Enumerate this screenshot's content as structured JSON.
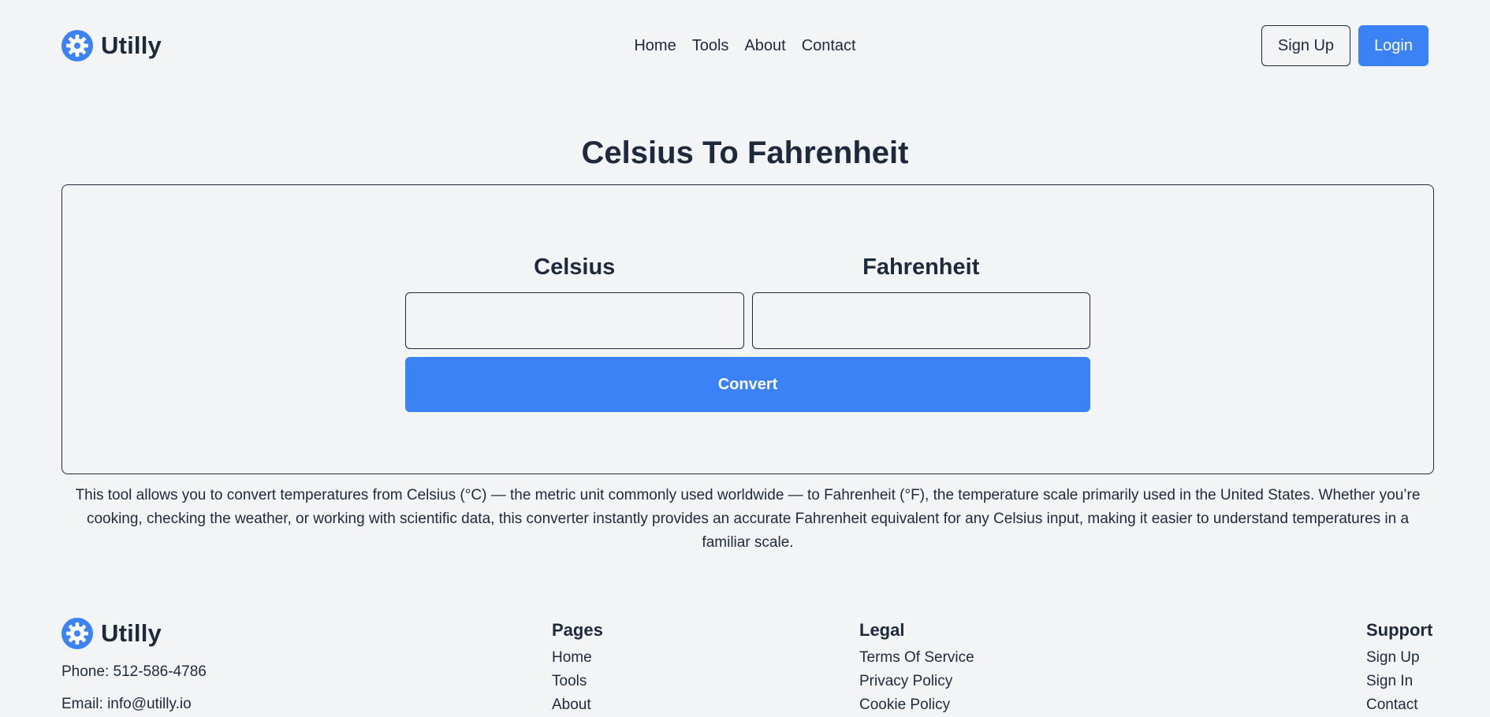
{
  "header": {
    "brand": "Utilly",
    "nav": [
      "Home",
      "Tools",
      "About",
      "Contact"
    ],
    "signup_label": "Sign Up",
    "login_label": "Login"
  },
  "main": {
    "title": "Celsius To Fahrenheit",
    "celsius_label": "Celsius",
    "fahrenheit_label": "Fahrenheit",
    "celsius_value": "",
    "fahrenheit_value": "",
    "convert_label": "Convert",
    "description": "This tool allows you to convert temperatures from Celsius (°C) — the metric unit commonly used worldwide — to Fahrenheit (°F), the temperature scale primarily used in the United States. Whether you’re cooking, checking the weather, or working with scientific data, this converter instantly provides an accurate Fahrenheit equivalent for any Celsius input, making it easier to understand temperatures in a familiar scale."
  },
  "footer": {
    "brand": "Utilly",
    "phone": "Phone: 512-586-4786",
    "email": "Email: info@utilly.io",
    "pages": {
      "heading": "Pages",
      "links": [
        "Home",
        "Tools",
        "About"
      ]
    },
    "legal": {
      "heading": "Legal",
      "links": [
        "Terms Of Service",
        "Privacy Policy",
        "Cookie Policy"
      ]
    },
    "support": {
      "heading": "Support",
      "links": [
        "Sign Up",
        "Sign In",
        "Contact"
      ]
    }
  },
  "colors": {
    "accent": "#3b82f6",
    "text": "#1e293b",
    "background": "#f3f4f6"
  },
  "icons": {
    "logo": "gear-icon"
  }
}
